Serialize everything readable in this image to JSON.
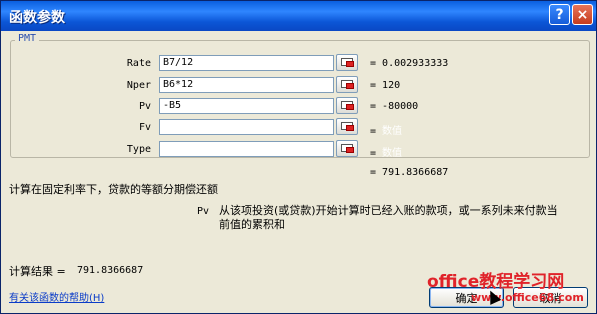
{
  "window": {
    "title": "函数参数",
    "help_button": "?",
    "close_button": "×"
  },
  "group": {
    "label": "PMT"
  },
  "args": [
    {
      "name": "Rate",
      "value": "B7/12",
      "result": "0.002933333"
    },
    {
      "name": "Nper",
      "value": "B6*12",
      "result": "120"
    },
    {
      "name": "Pv",
      "value": "-B5",
      "result": "-80000"
    },
    {
      "name": "Fv",
      "value": "",
      "result": "数值"
    },
    {
      "name": "Type",
      "value": "",
      "result": "数值"
    }
  ],
  "function_result": "791.8366687",
  "function_description": "计算在固定利率下，贷款的等额分期偿还额",
  "arg_help": {
    "name": "Pv",
    "text_line1": "从该项投资(或贷款)开始计算时已经入账的款项，或一系列未来付款当",
    "text_line2": "前值的累积和"
  },
  "calc_result_label": "计算结果 =",
  "calc_result_value": "791.8366687",
  "help_link": "有关该函数的帮助(H)",
  "buttons": {
    "ok": "确定",
    "cancel": "取消"
  },
  "watermark": {
    "line1": "office教程学习网",
    "line2": "www.office68.com"
  },
  "icons": [
    "help-icon",
    "close-icon",
    "cell-ref-icon",
    "cursor-icon"
  ],
  "colors": {
    "titlebar": "#0a5fe0",
    "dialog_bg": "#ece9d8",
    "link": "#0a3cc8",
    "watermark": "#e0232a"
  }
}
